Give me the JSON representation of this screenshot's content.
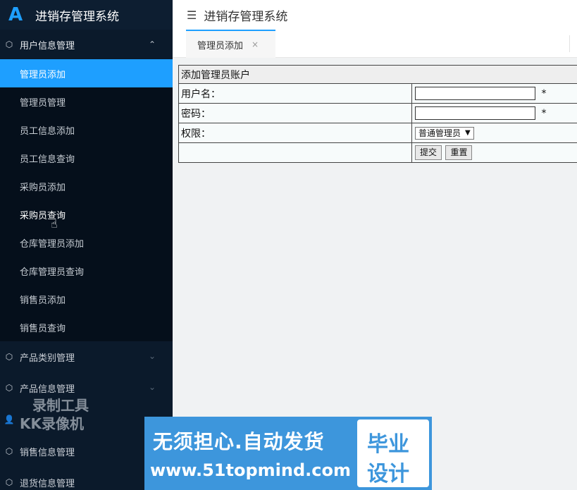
{
  "app": {
    "logo_letter": "A",
    "title": "进销存管理系统"
  },
  "header": {
    "menu_icon": "☰",
    "title": "进销存管理系统"
  },
  "sidebar": {
    "open_group": {
      "label": "用户信息管理",
      "icon": "cube-icon",
      "arrow": "⌃"
    },
    "items": [
      {
        "label": "管理员添加"
      },
      {
        "label": "管理员管理"
      },
      {
        "label": "员工信息添加"
      },
      {
        "label": "员工信息查询"
      },
      {
        "label": "采购员添加"
      },
      {
        "label": "采购员查询"
      },
      {
        "label": "仓库管理员添加"
      },
      {
        "label": "仓库管理员查询"
      },
      {
        "label": "销售员添加"
      },
      {
        "label": "销售员查询"
      }
    ],
    "groups": [
      {
        "label": "产品类别管理",
        "arrow": "⌄"
      },
      {
        "label": "产品信息管理",
        "arrow": "⌄"
      },
      {
        "label": ""
      },
      {
        "label": "销售信息管理"
      },
      {
        "label": "退货信息管理"
      }
    ]
  },
  "tabs": [
    {
      "label": "管理员添加",
      "close": "×"
    }
  ],
  "form": {
    "title": "添加管理员账户",
    "username_label": "用户名：",
    "password_label": "密码：",
    "role_label": "权限：",
    "required_mark": "*",
    "username_value": "",
    "password_value": "",
    "role_selected": "普通管理员",
    "submit_label": "提交",
    "reset_label": "重置"
  },
  "watermarks": {
    "kk_line1": "录制工具",
    "kk_line2": "KK录像机",
    "banner_line1": "无须担心.自动发货",
    "banner_line2": "www.51topmind.com",
    "banner_right1": "毕业",
    "banner_right2": "设计"
  },
  "colors": {
    "accent": "#1e9fff",
    "sidebar_bg": "#0b1a2b",
    "banner": "#3d96dc"
  }
}
